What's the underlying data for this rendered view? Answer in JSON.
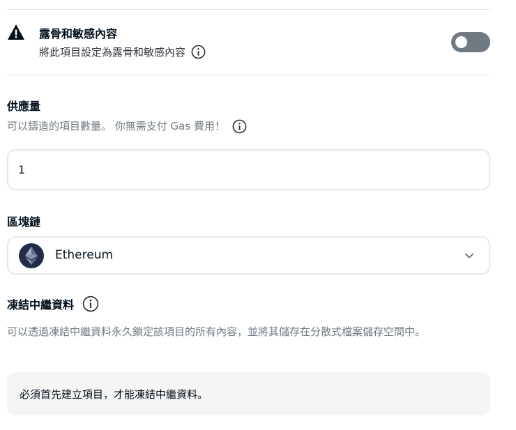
{
  "explicit": {
    "title": "露骨和敏感內容",
    "subtitle": "將此項目設定為露骨和敏感內容",
    "toggle_on": false
  },
  "supply": {
    "label": "供應量",
    "description": "可以鑄造的項目數量。 你無需支付 Gas 費用！",
    "value": "1"
  },
  "blockchain": {
    "label": "區塊鏈",
    "selected": "Ethereum"
  },
  "freeze_metadata": {
    "label": "凍結中繼資料",
    "description": "可以透過凍結中繼資料永久鎖定該項目的所有內容，並將其儲存在分散式檔案儲存空間中。",
    "note": "必須首先建立項目，才能凍結中繼資料。"
  }
}
